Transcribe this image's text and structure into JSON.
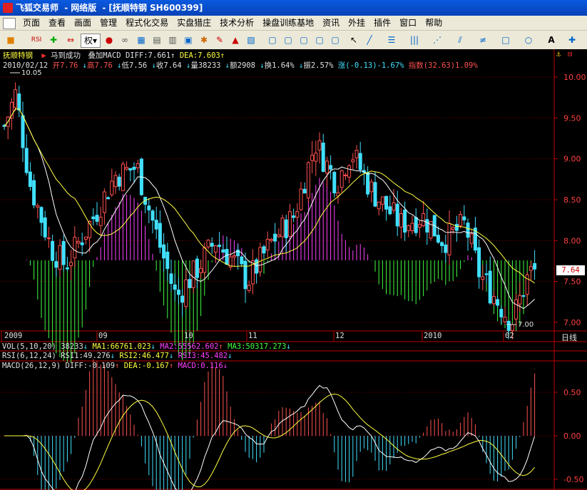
{
  "window": {
    "app_name": "飞狐交易师",
    "edition": "网络版",
    "stock_bracket": "[抚顺特钢 SH600399]"
  },
  "menu": [
    "页面",
    "查看",
    "画面",
    "管理",
    "程式化交易",
    "实盘猎庄",
    "技术分析",
    "操盘训练基地",
    "资讯",
    "外挂",
    "插件",
    "窗口",
    "帮助"
  ],
  "toolbar": {
    "fq_label": "权"
  },
  "header": {
    "stock_name": "抚顺特钢",
    "marquee": "马到成功",
    "overlay": "叠加MACD",
    "diff": "DIFF:7.661",
    "dea": "DEA:7.603"
  },
  "quote": {
    "date": "2010/02/12",
    "open": "开7.76",
    "high": "高7.76",
    "low": "低7.56",
    "close": "收7.64",
    "volume": "量38233",
    "amount": "额2908",
    "turnover": "换1.64%",
    "amplitude": "振2.57%",
    "change": "涨(-0.13)-1.67%",
    "index": "指数(32.63)1.09%"
  },
  "price_axis": [
    "10.00",
    "9.50",
    "9.00",
    "8.50",
    "8.00",
    "7.50",
    "7.00"
  ],
  "current_price": "7.64",
  "high_marker": "10.05",
  "low_marker": "7.00",
  "time_axis": [
    "2009",
    "09",
    "10",
    "11",
    "12",
    "2010",
    "02"
  ],
  "period": "日线",
  "vol_line": {
    "params": "VOL(5,10,20)",
    "value": "38233",
    "ma1": "MA1:66761.023",
    "ma2": "MA2:55562.602",
    "ma3": "MA3:50317.273"
  },
  "rsi_line": {
    "params": "RSI(6,12,24)",
    "rsi1": "RSI1:49.276",
    "rsi2": "RSI2:46.477",
    "rsi3": "RSI3:45.482"
  },
  "macd_line": {
    "params": "MACD(26,12,9)",
    "diff": "DIFF:-0.109",
    "dea": "DEA:-0.167",
    "macd": "MACD:0.116"
  },
  "macd_axis": [
    "0.50",
    "0.00",
    "-0.50"
  ],
  "colors": {
    "up": "#ff5050",
    "down": "#40e0ff",
    "ma_white": "#ffffff",
    "ma_yellow": "#ffff40",
    "panel_border": "#c00000"
  }
}
